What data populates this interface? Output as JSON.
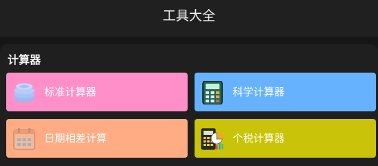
{
  "header": {
    "title": "工具大全"
  },
  "section": {
    "title": "计算器"
  },
  "cards": [
    {
      "label": "标准计算器",
      "icon": "coins-icon",
      "color": "#ff8fc8"
    },
    {
      "label": "科学计算器",
      "icon": "calculator-icon",
      "color": "#66b2ff"
    },
    {
      "label": "日期相差计算",
      "icon": "calendar-icon",
      "color": "#ffac84"
    },
    {
      "label": "个税计算器",
      "icon": "tax-calculator-icon",
      "color": "#c9c40a"
    }
  ]
}
